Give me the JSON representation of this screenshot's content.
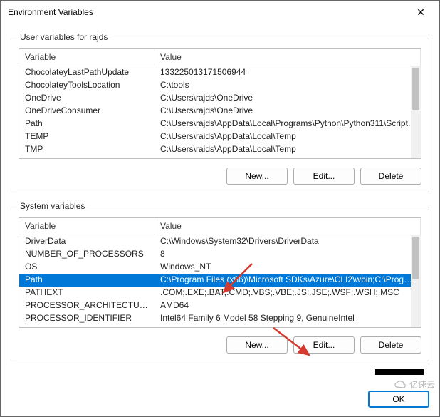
{
  "window": {
    "title": "Environment Variables",
    "close_glyph": "✕"
  },
  "user_section": {
    "label": "User variables for rajds",
    "columns": {
      "variable": "Variable",
      "value": "Value"
    },
    "rows": [
      {
        "name": "ChocolateyLastPathUpdate",
        "value": "133225013171506944"
      },
      {
        "name": "ChocolateyToolsLocation",
        "value": "C:\\tools"
      },
      {
        "name": "OneDrive",
        "value": "C:\\Users\\rajds\\OneDrive"
      },
      {
        "name": "OneDriveConsumer",
        "value": "C:\\Users\\rajds\\OneDrive"
      },
      {
        "name": "Path",
        "value": "C:\\Users\\rajds\\AppData\\Local\\Programs\\Python\\Python311\\Script..."
      },
      {
        "name": "TEMP",
        "value": "C:\\Users\\raids\\AppData\\Local\\Temp"
      },
      {
        "name": "TMP",
        "value": "C:\\Users\\raids\\AppData\\Local\\Temp"
      }
    ],
    "buttons": {
      "new": "New...",
      "edit": "Edit...",
      "delete": "Delete"
    }
  },
  "system_section": {
    "label": "System variables",
    "columns": {
      "variable": "Variable",
      "value": "Value"
    },
    "rows": [
      {
        "name": "DriverData",
        "value": "C:\\Windows\\System32\\Drivers\\DriverData",
        "selected": false
      },
      {
        "name": "NUMBER_OF_PROCESSORS",
        "value": "8",
        "selected": false
      },
      {
        "name": "OS",
        "value": "Windows_NT",
        "selected": false
      },
      {
        "name": "Path",
        "value": "C:\\Program Files (x86)\\Microsoft SDKs\\Azure\\CLI2\\wbin;C:\\Progra...",
        "selected": true
      },
      {
        "name": "PATHEXT",
        "value": ".COM;.EXE;.BAT;.CMD;.VBS;.VBE;.JS;.JSE;.WSF;.WSH;.MSC",
        "selected": false
      },
      {
        "name": "PROCESSOR_ARCHITECTURE",
        "value": "AMD64",
        "selected": false
      },
      {
        "name": "PROCESSOR_IDENTIFIER",
        "value": "Intel64 Family 6 Model 58 Stepping 9, GenuineIntel",
        "selected": false
      }
    ],
    "buttons": {
      "new": "New...",
      "edit": "Edit...",
      "delete": "Delete"
    }
  },
  "footer": {
    "ok": "OK"
  },
  "watermark": "亿速云",
  "annotation_color": "#d43a2f"
}
